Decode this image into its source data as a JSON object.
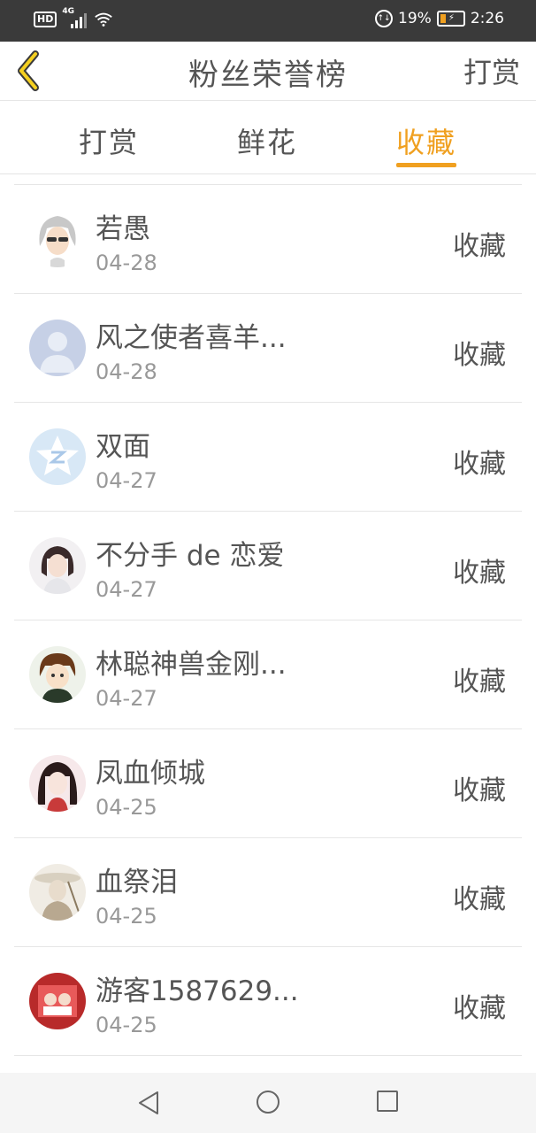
{
  "status_bar": {
    "hd": "HD",
    "network": "4G",
    "battery_percent": "19%",
    "time": "2:26"
  },
  "header": {
    "title": "粉丝荣誉榜",
    "action": "打赏"
  },
  "tabs": [
    {
      "label": "打赏",
      "active": false
    },
    {
      "label": "鲜花",
      "active": false
    },
    {
      "label": "收藏",
      "active": true
    }
  ],
  "list": [
    {
      "name": "若愚",
      "date": "04-28",
      "action": "收藏",
      "avatar": "avatar-silver-hair"
    },
    {
      "name": "风之使者喜羊...",
      "date": "04-28",
      "action": "收藏",
      "avatar": "avatar-default-person"
    },
    {
      "name": "双面",
      "date": "04-27",
      "action": "收藏",
      "avatar": "avatar-qq-star"
    },
    {
      "name": "不分手 de 恋爱",
      "date": "04-27",
      "action": "收藏",
      "avatar": "avatar-girl-photo"
    },
    {
      "name": "林聪神兽金刚...",
      "date": "04-27",
      "action": "收藏",
      "avatar": "avatar-anime-boy"
    },
    {
      "name": "凤血倾城",
      "date": "04-25",
      "action": "收藏",
      "avatar": "avatar-anime-girl"
    },
    {
      "name": "血祭泪",
      "date": "04-25",
      "action": "收藏",
      "avatar": "avatar-ink-warrior"
    },
    {
      "name": "游客1587629...",
      "date": "04-25",
      "action": "收藏",
      "avatar": "avatar-red-photo"
    }
  ],
  "colors": {
    "accent": "#f0a020",
    "text": "#555555",
    "subtext": "#999999"
  }
}
